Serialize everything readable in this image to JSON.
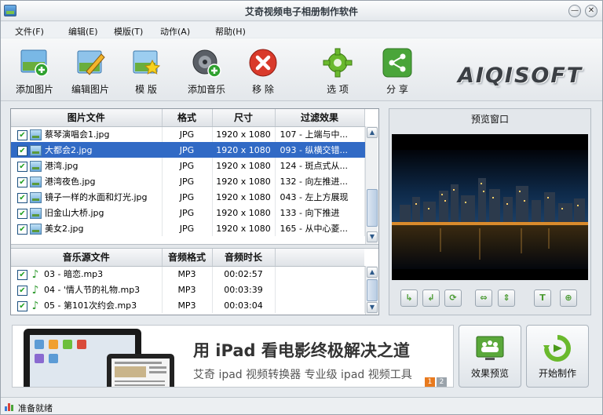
{
  "window": {
    "title": "艾奇视频电子相册制作软件",
    "minimize": "—",
    "close": "✕"
  },
  "menu": [
    {
      "label": "文件(F)"
    },
    {
      "label": "编辑(E)"
    },
    {
      "label": "模版(T)"
    },
    {
      "label": "动作(A)"
    },
    {
      "label": "帮助(H)"
    }
  ],
  "toolbar": {
    "add_image": "添加图片",
    "edit_image": "编辑图片",
    "template": "模 版",
    "add_music": "添加音乐",
    "remove": "移 除",
    "options": "选 项",
    "share": "分 享",
    "brand": "AIQISOFT"
  },
  "image_table": {
    "headers": [
      "图片文件",
      "格式",
      "尺寸",
      "过滤效果"
    ],
    "rows": [
      {
        "file": "蔡琴演唱会1.jpg",
        "format": "JPG",
        "size": "1920 x 1080",
        "effect": "107 - 上端与中...",
        "checked": true,
        "selected": false
      },
      {
        "file": "大都会2.jpg",
        "format": "JPG",
        "size": "1920 x 1080",
        "effect": "093 - 纵横交错...",
        "checked": true,
        "selected": true
      },
      {
        "file": "港湾.jpg",
        "format": "JPG",
        "size": "1920 x 1080",
        "effect": "124 - 斑点式从...",
        "checked": true,
        "selected": false
      },
      {
        "file": "港湾夜色.jpg",
        "format": "JPG",
        "size": "1920 x 1080",
        "effect": "132 - 向左推进...",
        "checked": true,
        "selected": false
      },
      {
        "file": "镜子一样的水面和灯光.jpg",
        "format": "JPG",
        "size": "1920 x 1080",
        "effect": "043 - 左上方展现",
        "checked": true,
        "selected": false
      },
      {
        "file": "旧金山大桥.jpg",
        "format": "JPG",
        "size": "1920 x 1080",
        "effect": "133 - 向下推进",
        "checked": true,
        "selected": false
      },
      {
        "file": "美女2.jpg",
        "format": "JPG",
        "size": "1920 x 1080",
        "effect": "165 - 从中心菱...",
        "checked": true,
        "selected": false
      }
    ]
  },
  "music_table": {
    "headers": [
      "音乐源文件",
      "音频格式",
      "音频时长"
    ],
    "rows": [
      {
        "file": "03 - 暗恋.mp3",
        "format": "MP3",
        "duration": "00:02:57",
        "checked": true
      },
      {
        "file": "04 - '情人节的礼物.mp3",
        "format": "MP3",
        "duration": "00:03:39",
        "checked": true
      },
      {
        "file": "05 - 第101次约会.mp3",
        "format": "MP3",
        "duration": "00:03:04",
        "checked": true
      }
    ]
  },
  "preview": {
    "title": "预览窗口"
  },
  "preview_controls": [
    "↳",
    "↲",
    "⟳",
    "⇔",
    "⇕",
    "T",
    "⊕"
  ],
  "banner": {
    "line1": "用 iPad 看电影终极解决之道",
    "line2": "艾奇 ipad 视频转换器  专业级 ipad 视频工具",
    "page1": "1",
    "page2": "2"
  },
  "actions": {
    "preview_effect": "效果预览",
    "start": "开始制作"
  },
  "status": {
    "text": "准备就绪"
  },
  "colors": {
    "selection": "#316ac5",
    "accent_green": "#4a9a30",
    "remove_red": "#d93a2b"
  }
}
